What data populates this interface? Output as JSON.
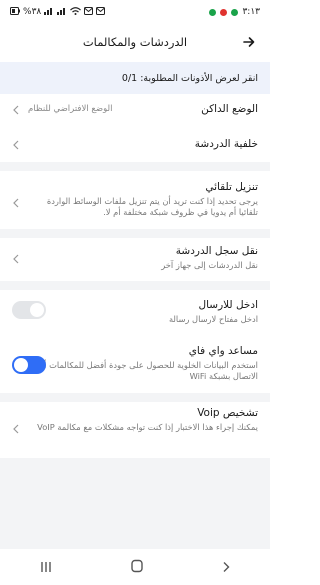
{
  "status_bar": {
    "time": "٣:١٣",
    "battery": "%٣٨"
  },
  "header": {
    "title": "الدردشات والمكالمات"
  },
  "notice": {
    "text": "انقر لعرض الأذونات المطلوبة: 0/1"
  },
  "settings": {
    "dark_mode": {
      "label": "الوضع الداكن",
      "value": "الوضع الافتراضي للنظام"
    },
    "chat_background": {
      "label": "خلفية الدردشة"
    },
    "auto_download": {
      "label": "تنزيل تلقائي",
      "sub": "يرجى تحديد إذا كنت تريد أن يتم تنزيل ملفات الوسائط الواردة تلقائيا أم يدويا في ظروف شبكة مختلفة أم لا."
    },
    "chat_history": {
      "label": "نقل سجل الدردشة",
      "sub": "نقل الدردشات إلى جهاز آخر"
    },
    "enter_to_send": {
      "label": "ادخل للارسال",
      "sub": "ادخل مفتاح لارسال رسالة",
      "enabled": false
    },
    "wifi_assistant": {
      "label": "مساعد واي فاي",
      "sub": "استخدم البيانات الخلوية للحصول على جودة أفضل للمكالمات أثناء الاتصال بشبكة WiFi",
      "enabled": true
    },
    "voip_diagnostics": {
      "label": "تشخيص Voip",
      "sub": "يمكنك إجراء هذا الاختبار إذا كنت تواجه مشكلات مع مكالمة VoIP"
    }
  },
  "colors": {
    "accent": "#2f6df6",
    "toggle_off": "#e3e5e8",
    "section_gap": "#f3f4f6",
    "notice_bg": "#eef2fb"
  },
  "icons": {
    "back": "arrow-right-icon",
    "chevron": "chevron-left-icon",
    "nav_back": "chevron-right-icon",
    "nav_home": "circle-icon",
    "nav_recents": "bars-icon"
  }
}
